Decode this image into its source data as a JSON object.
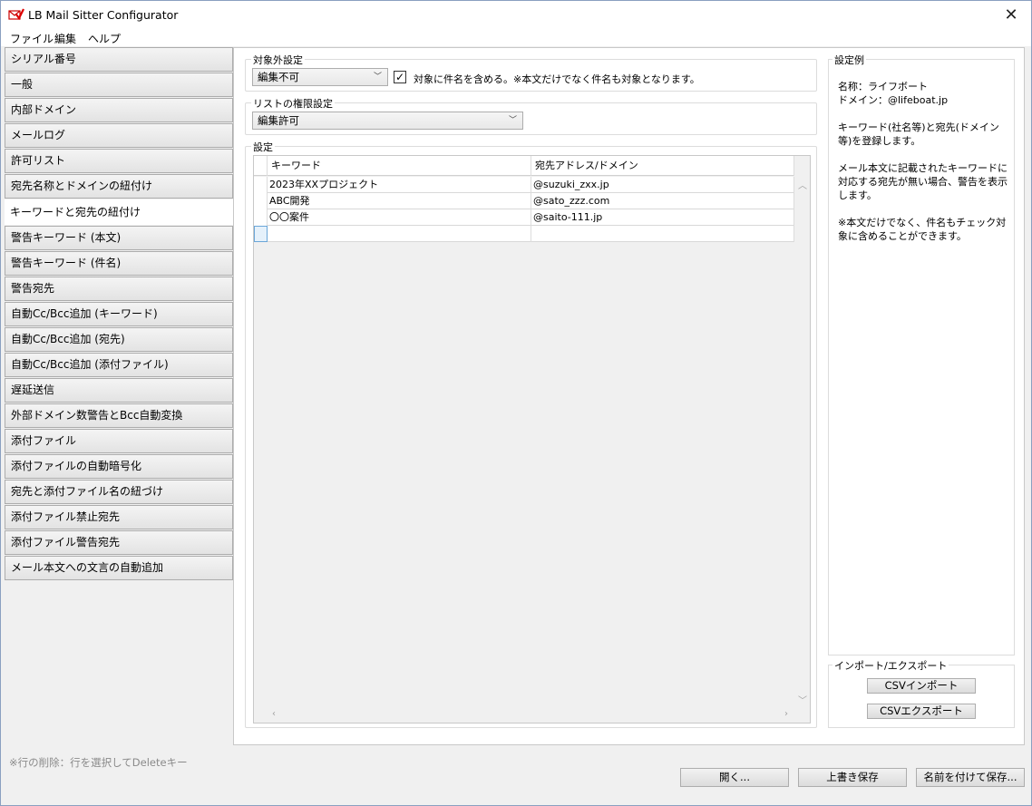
{
  "window": {
    "title": "LB Mail Sitter Configurator"
  },
  "menu": [
    "ファイル",
    "編集",
    "ヘルプ"
  ],
  "sidebar": {
    "items": [
      "シリアル番号",
      "一般",
      "内部ドメイン",
      "メールログ",
      "許可リスト",
      "宛先名称とドメインの紐付け",
      "キーワードと宛先の紐付け",
      "警告キーワード (本文)",
      "警告キーワード (件名)",
      "警告宛先",
      "自動Cc/Bcc追加 (キーワード)",
      "自動Cc/Bcc追加 (宛先)",
      "自動Cc/Bcc追加 (添付ファイル)",
      "遅延送信",
      "外部ドメイン数警告とBcc自動変換",
      "添付ファイル",
      "添付ファイルの自動暗号化",
      "宛先と添付ファイル名の紐づけ",
      "添付ファイル禁止宛先",
      "添付ファイル警告宛先",
      "メール本文への文言の自動追加"
    ],
    "active_index": 6
  },
  "exclusion": {
    "label": "対象外設定",
    "combo_value": "編集不可",
    "checkbox_checked": true,
    "checkbox_label": "対象に件名を含める。※本文だけでなく件名も対象となります。"
  },
  "permission": {
    "label": "リストの権限設定",
    "combo_value": "編集許可"
  },
  "settings": {
    "label": "設定",
    "columns": [
      "キーワード",
      "宛先アドレス/ドメイン"
    ],
    "rows": [
      [
        "2023年XXプロジェクト",
        "@suzuki_zxx.jp"
      ],
      [
        "ABC開発",
        "@sato_zzz.com"
      ],
      [
        "〇〇案件",
        "@saito-111.jp"
      ],
      [
        "",
        ""
      ]
    ]
  },
  "example": {
    "label": "設定例",
    "text": "名称：ライフボート\nドメイン：@lifeboat.jp\n\nキーワード(社名等)と宛先(ドメイン等)を登録します。\n\nメール本文に記載されたキーワードに対応する宛先が無い場合、警告を表示します。\n\n※本文だけでなく、件名もチェック対象に含めることができます。"
  },
  "import_export": {
    "label": "インポート/エクスポート",
    "import_label": "CSVインポート",
    "export_label": "CSVエクスポート"
  },
  "footer": {
    "note": "※行の削除：行を選択してDeleteキー",
    "open_label": "開く...",
    "save_label": "上書き保存",
    "save_as_label": "名前を付けて保存..."
  }
}
